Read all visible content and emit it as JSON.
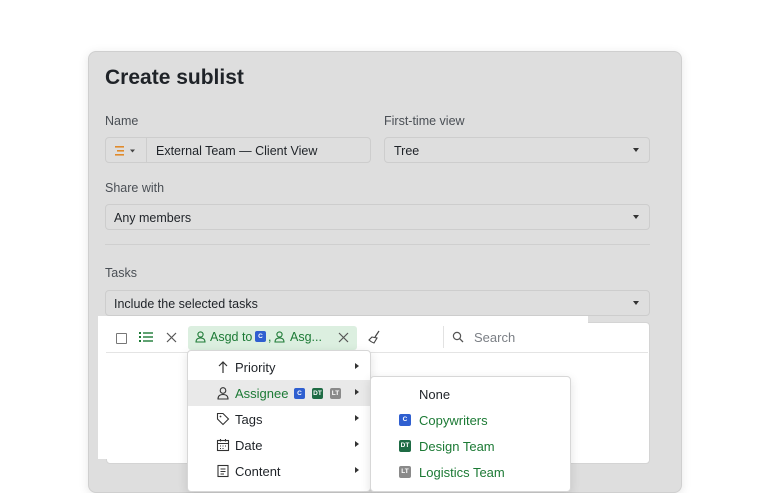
{
  "dialog": {
    "title": "Create sublist",
    "name_label": "Name",
    "name_value": "External Team — Client View",
    "first_view_label": "First-time view",
    "first_view_value": "Tree",
    "share_label": "Share with",
    "share_value": "Any members",
    "tasks_label": "Tasks",
    "tasks_value": "Include the selected tasks"
  },
  "toolbar": {
    "filter_chip_prefix": "Asgd to",
    "filter_chip_badge": "C",
    "filter_chip_sep": ",",
    "filter_chip_suffix": "Asg...",
    "search_placeholder": "Search"
  },
  "menu": {
    "items": [
      {
        "label": "Priority",
        "icon": "arrow-up-icon"
      },
      {
        "label": "Assignee",
        "icon": "person-icon",
        "badges": [
          "C",
          "DT",
          "LT"
        ]
      },
      {
        "label": "Tags",
        "icon": "tag-icon"
      },
      {
        "label": "Date",
        "icon": "calendar-icon"
      },
      {
        "label": "Content",
        "icon": "document-icon"
      }
    ]
  },
  "submenu": {
    "items": [
      {
        "label": "None"
      },
      {
        "label": "Copywriters",
        "badge": "C",
        "color": "#2f5fd0"
      },
      {
        "label": "Design Team",
        "badge": "DT",
        "color": "#1e6b44"
      },
      {
        "label": "Logistics Team",
        "badge": "LT",
        "color": "#8a8a8a"
      }
    ]
  },
  "colors": {
    "accent_green": "#1c7a35",
    "name_icon_orange": "#e08a2c"
  }
}
